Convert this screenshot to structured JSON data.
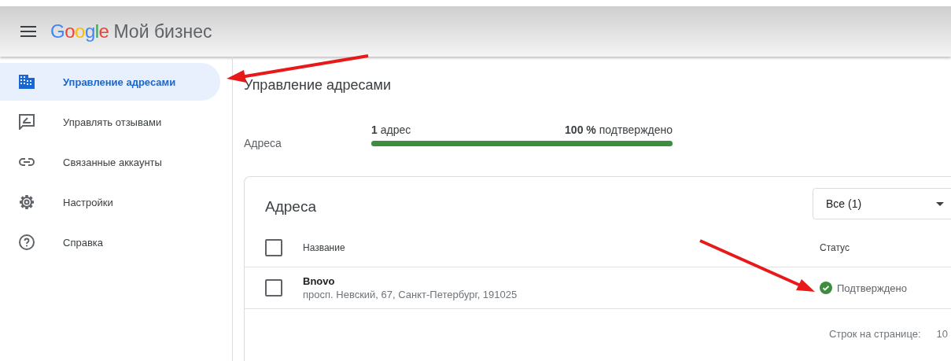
{
  "header": {
    "logo": "Google",
    "product": "Мой бизнес"
  },
  "sidebar": {
    "items": [
      {
        "label": "Управление адресами",
        "kind": "building",
        "selected": true
      },
      {
        "label": "Управлять отзывами",
        "kind": "review",
        "selected": false
      },
      {
        "label": "Связанные аккаунты",
        "kind": "link",
        "selected": false
      },
      {
        "label": "Настройки",
        "kind": "gear",
        "selected": false
      },
      {
        "label": "Справка",
        "kind": "help",
        "selected": false
      }
    ]
  },
  "page_title": "Управление адресами",
  "summary": {
    "label": "Адреса",
    "count": "**1** адрес",
    "verified": "**100 %** подтверждено",
    "level": 1
  },
  "card": {
    "title": "Адреса",
    "filter": "Все (1)",
    "columns": {
      "name": "Название",
      "status": "Статус"
    },
    "header_checked": false,
    "rows": [
      {
        "name": "Bnovo",
        "address": "просп. Невский, 67, Санкт-Петербург, 191025",
        "status": "Подтверждено",
        "kind": "verified",
        "checked": false
      }
    ],
    "rows_per_page_label": "Строк на странице:",
    "rows_per_page": "10"
  }
}
